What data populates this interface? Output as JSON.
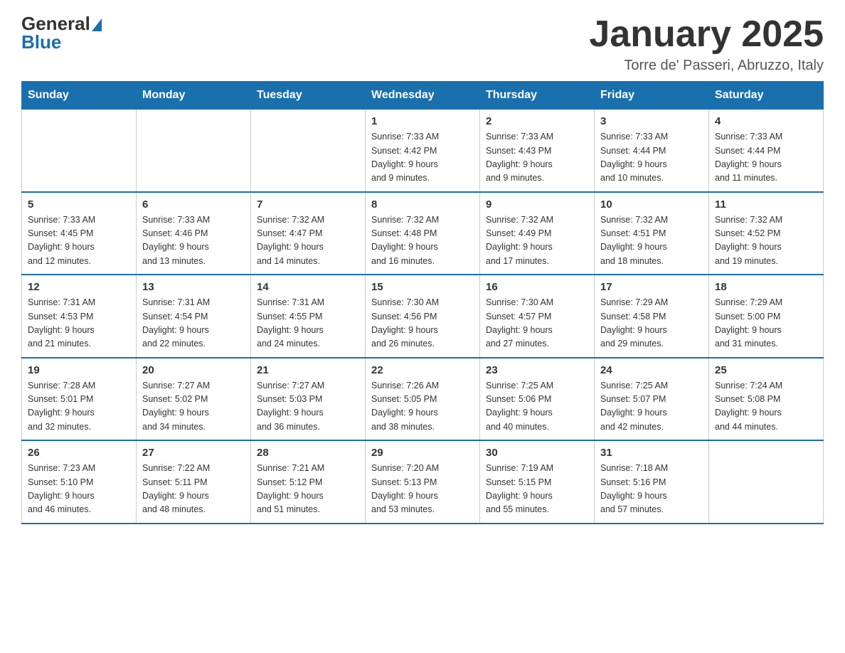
{
  "header": {
    "logo_general": "General",
    "logo_blue": "Blue",
    "title": "January 2025",
    "subtitle": "Torre de' Passeri, Abruzzo, Italy"
  },
  "days_of_week": [
    "Sunday",
    "Monday",
    "Tuesday",
    "Wednesday",
    "Thursday",
    "Friday",
    "Saturday"
  ],
  "weeks": [
    [
      {
        "day": "",
        "info": ""
      },
      {
        "day": "",
        "info": ""
      },
      {
        "day": "",
        "info": ""
      },
      {
        "day": "1",
        "info": "Sunrise: 7:33 AM\nSunset: 4:42 PM\nDaylight: 9 hours\nand 9 minutes."
      },
      {
        "day": "2",
        "info": "Sunrise: 7:33 AM\nSunset: 4:43 PM\nDaylight: 9 hours\nand 9 minutes."
      },
      {
        "day": "3",
        "info": "Sunrise: 7:33 AM\nSunset: 4:44 PM\nDaylight: 9 hours\nand 10 minutes."
      },
      {
        "day": "4",
        "info": "Sunrise: 7:33 AM\nSunset: 4:44 PM\nDaylight: 9 hours\nand 11 minutes."
      }
    ],
    [
      {
        "day": "5",
        "info": "Sunrise: 7:33 AM\nSunset: 4:45 PM\nDaylight: 9 hours\nand 12 minutes."
      },
      {
        "day": "6",
        "info": "Sunrise: 7:33 AM\nSunset: 4:46 PM\nDaylight: 9 hours\nand 13 minutes."
      },
      {
        "day": "7",
        "info": "Sunrise: 7:32 AM\nSunset: 4:47 PM\nDaylight: 9 hours\nand 14 minutes."
      },
      {
        "day": "8",
        "info": "Sunrise: 7:32 AM\nSunset: 4:48 PM\nDaylight: 9 hours\nand 16 minutes."
      },
      {
        "day": "9",
        "info": "Sunrise: 7:32 AM\nSunset: 4:49 PM\nDaylight: 9 hours\nand 17 minutes."
      },
      {
        "day": "10",
        "info": "Sunrise: 7:32 AM\nSunset: 4:51 PM\nDaylight: 9 hours\nand 18 minutes."
      },
      {
        "day": "11",
        "info": "Sunrise: 7:32 AM\nSunset: 4:52 PM\nDaylight: 9 hours\nand 19 minutes."
      }
    ],
    [
      {
        "day": "12",
        "info": "Sunrise: 7:31 AM\nSunset: 4:53 PM\nDaylight: 9 hours\nand 21 minutes."
      },
      {
        "day": "13",
        "info": "Sunrise: 7:31 AM\nSunset: 4:54 PM\nDaylight: 9 hours\nand 22 minutes."
      },
      {
        "day": "14",
        "info": "Sunrise: 7:31 AM\nSunset: 4:55 PM\nDaylight: 9 hours\nand 24 minutes."
      },
      {
        "day": "15",
        "info": "Sunrise: 7:30 AM\nSunset: 4:56 PM\nDaylight: 9 hours\nand 26 minutes."
      },
      {
        "day": "16",
        "info": "Sunrise: 7:30 AM\nSunset: 4:57 PM\nDaylight: 9 hours\nand 27 minutes."
      },
      {
        "day": "17",
        "info": "Sunrise: 7:29 AM\nSunset: 4:58 PM\nDaylight: 9 hours\nand 29 minutes."
      },
      {
        "day": "18",
        "info": "Sunrise: 7:29 AM\nSunset: 5:00 PM\nDaylight: 9 hours\nand 31 minutes."
      }
    ],
    [
      {
        "day": "19",
        "info": "Sunrise: 7:28 AM\nSunset: 5:01 PM\nDaylight: 9 hours\nand 32 minutes."
      },
      {
        "day": "20",
        "info": "Sunrise: 7:27 AM\nSunset: 5:02 PM\nDaylight: 9 hours\nand 34 minutes."
      },
      {
        "day": "21",
        "info": "Sunrise: 7:27 AM\nSunset: 5:03 PM\nDaylight: 9 hours\nand 36 minutes."
      },
      {
        "day": "22",
        "info": "Sunrise: 7:26 AM\nSunset: 5:05 PM\nDaylight: 9 hours\nand 38 minutes."
      },
      {
        "day": "23",
        "info": "Sunrise: 7:25 AM\nSunset: 5:06 PM\nDaylight: 9 hours\nand 40 minutes."
      },
      {
        "day": "24",
        "info": "Sunrise: 7:25 AM\nSunset: 5:07 PM\nDaylight: 9 hours\nand 42 minutes."
      },
      {
        "day": "25",
        "info": "Sunrise: 7:24 AM\nSunset: 5:08 PM\nDaylight: 9 hours\nand 44 minutes."
      }
    ],
    [
      {
        "day": "26",
        "info": "Sunrise: 7:23 AM\nSunset: 5:10 PM\nDaylight: 9 hours\nand 46 minutes."
      },
      {
        "day": "27",
        "info": "Sunrise: 7:22 AM\nSunset: 5:11 PM\nDaylight: 9 hours\nand 48 minutes."
      },
      {
        "day": "28",
        "info": "Sunrise: 7:21 AM\nSunset: 5:12 PM\nDaylight: 9 hours\nand 51 minutes."
      },
      {
        "day": "29",
        "info": "Sunrise: 7:20 AM\nSunset: 5:13 PM\nDaylight: 9 hours\nand 53 minutes."
      },
      {
        "day": "30",
        "info": "Sunrise: 7:19 AM\nSunset: 5:15 PM\nDaylight: 9 hours\nand 55 minutes."
      },
      {
        "day": "31",
        "info": "Sunrise: 7:18 AM\nSunset: 5:16 PM\nDaylight: 9 hours\nand 57 minutes."
      },
      {
        "day": "",
        "info": ""
      }
    ]
  ]
}
